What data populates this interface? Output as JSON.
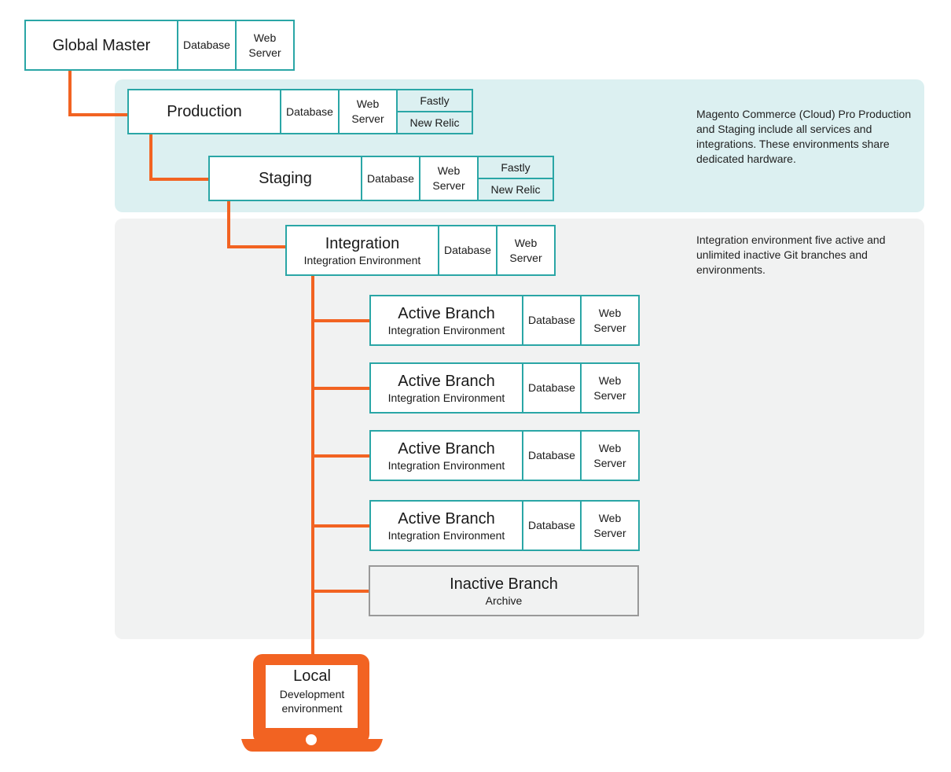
{
  "colors": {
    "accent_orange": "#f26322",
    "teal": "#2aa6a6",
    "pro_panel": "#dcf0f1",
    "int_panel": "#f1f2f2",
    "inactive_border": "#999999"
  },
  "global_master": {
    "title": "Global Master",
    "services": [
      "Database",
      "Web\nServer"
    ]
  },
  "production": {
    "title": "Production",
    "services": [
      "Database",
      "Web\nServer"
    ],
    "integrations": [
      "Fastly",
      "New Relic"
    ]
  },
  "staging": {
    "title": "Staging",
    "services": [
      "Database",
      "Web\nServer"
    ],
    "integrations": [
      "Fastly",
      "New Relic"
    ]
  },
  "integration": {
    "title": "Integration",
    "subtitle": "Integration Environment",
    "services": [
      "Database",
      "Web\nServer"
    ]
  },
  "active_branches": [
    {
      "title": "Active Branch",
      "subtitle": "Integration Environment",
      "services": [
        "Database",
        "Web\nServer"
      ]
    },
    {
      "title": "Active Branch",
      "subtitle": "Integration Environment",
      "services": [
        "Database",
        "Web\nServer"
      ]
    },
    {
      "title": "Active Branch",
      "subtitle": "Integration Environment",
      "services": [
        "Database",
        "Web\nServer"
      ]
    },
    {
      "title": "Active Branch",
      "subtitle": "Integration Environment",
      "services": [
        "Database",
        "Web\nServer"
      ]
    }
  ],
  "inactive_branch": {
    "title": "Inactive Branch",
    "subtitle": "Archive"
  },
  "local": {
    "title": "Local",
    "subtitle": "Development environment"
  },
  "notes": {
    "pro": "Magento Commerce (Cloud) Pro Production and Staging include all services and integrations. These environments share dedicated hardware.",
    "integration": "Integration environment five active and unlimited inactive Git branches and environments."
  }
}
